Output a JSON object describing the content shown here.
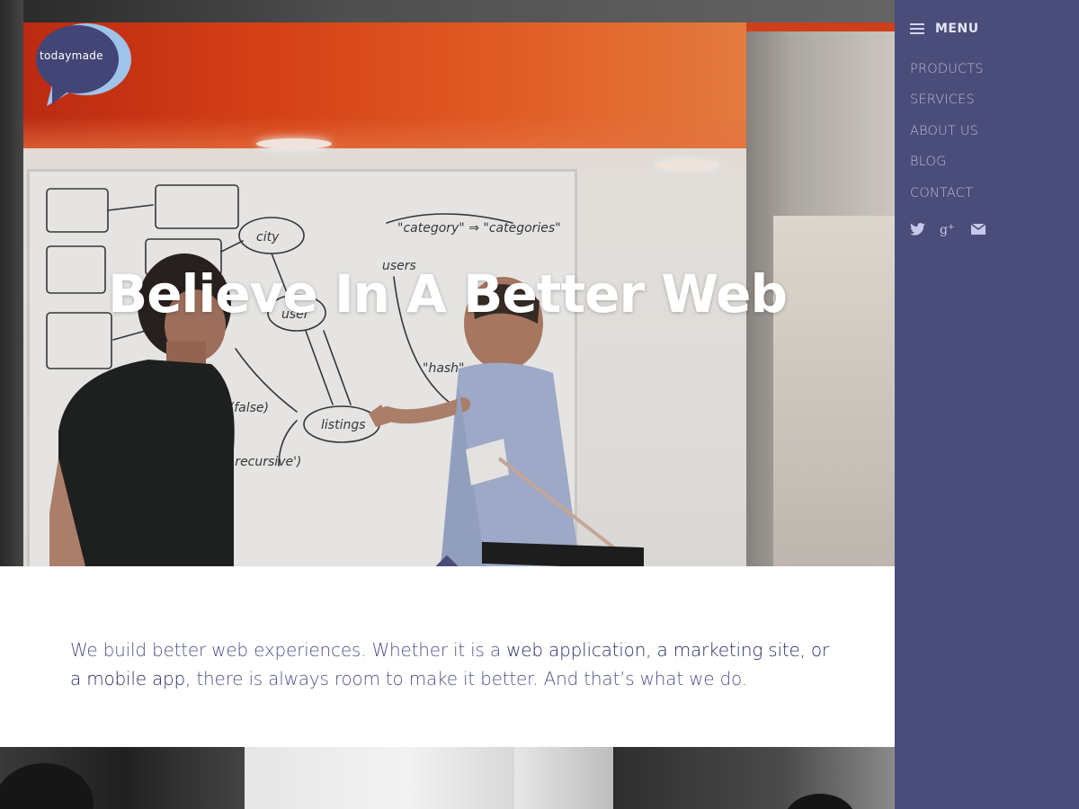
{
  "brand": {
    "logo_text": "todaymade"
  },
  "hero": {
    "headline": "Believe In A Better Web"
  },
  "intro": {
    "text_before": "We build better web experiences. Whether it is a ",
    "link_text": "web application, a marketing site, or a mobile app,",
    "text_after": " there is always room to make it better. And that’s what we do."
  },
  "sidebar": {
    "menu_label": "MENU",
    "nav": [
      {
        "label": "PRODUCTS"
      },
      {
        "label": "SERVICES"
      },
      {
        "label": "ABOUT US"
      },
      {
        "label": "BLOG"
      },
      {
        "label": "CONTACT"
      }
    ],
    "social": [
      {
        "icon": "twitter-icon"
      },
      {
        "icon": "google-plus-icon"
      },
      {
        "icon": "mail-icon"
      }
    ]
  },
  "colors": {
    "sidebar_bg": "#4a4c7a",
    "nav_text": "#b8bbe0",
    "intro_text": "#4f5486",
    "intro_link": "#2b2f64",
    "accent_orange": "#e8521c"
  }
}
